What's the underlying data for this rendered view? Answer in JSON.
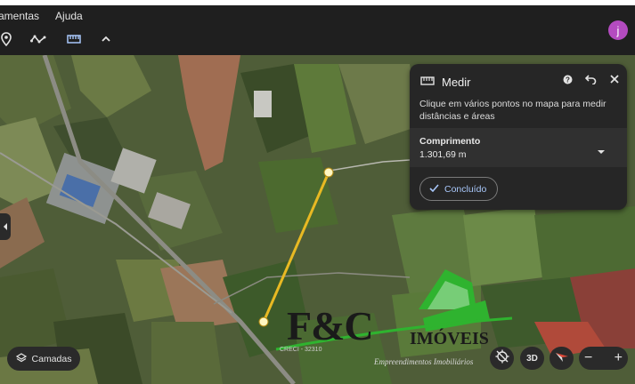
{
  "menu": {
    "items": [
      "amentas",
      "Ajuda"
    ]
  },
  "toolbar": {
    "icons": [
      "map-pin-icon",
      "path-icon",
      "ruler-icon",
      "chevron-up-icon"
    ]
  },
  "account": {
    "initial": "j",
    "color": "#b44bc0"
  },
  "measure_panel": {
    "title": "Medir",
    "description": "Clique em vários pontos no mapa para medir distâncias e áreas",
    "metric_label": "Comprimento",
    "metric_value": "1.301,69 m",
    "done_label": "Concluído",
    "accent_color": "#a8c7fa"
  },
  "measurement": {
    "line_color": "#e8b923",
    "point_color": "#fff7c2"
  },
  "map_controls": {
    "layers_label": "Camadas",
    "three_d_label": "3D",
    "zoom_out_label": "−",
    "zoom_in_label": "+"
  },
  "watermark": {
    "brand_main": "F&C",
    "brand_sub": "IMÓVEIS",
    "tagline": "Empreendimentos Imobiliários",
    "small_text": "CRECI - 32310",
    "green": "#2fb32f"
  }
}
